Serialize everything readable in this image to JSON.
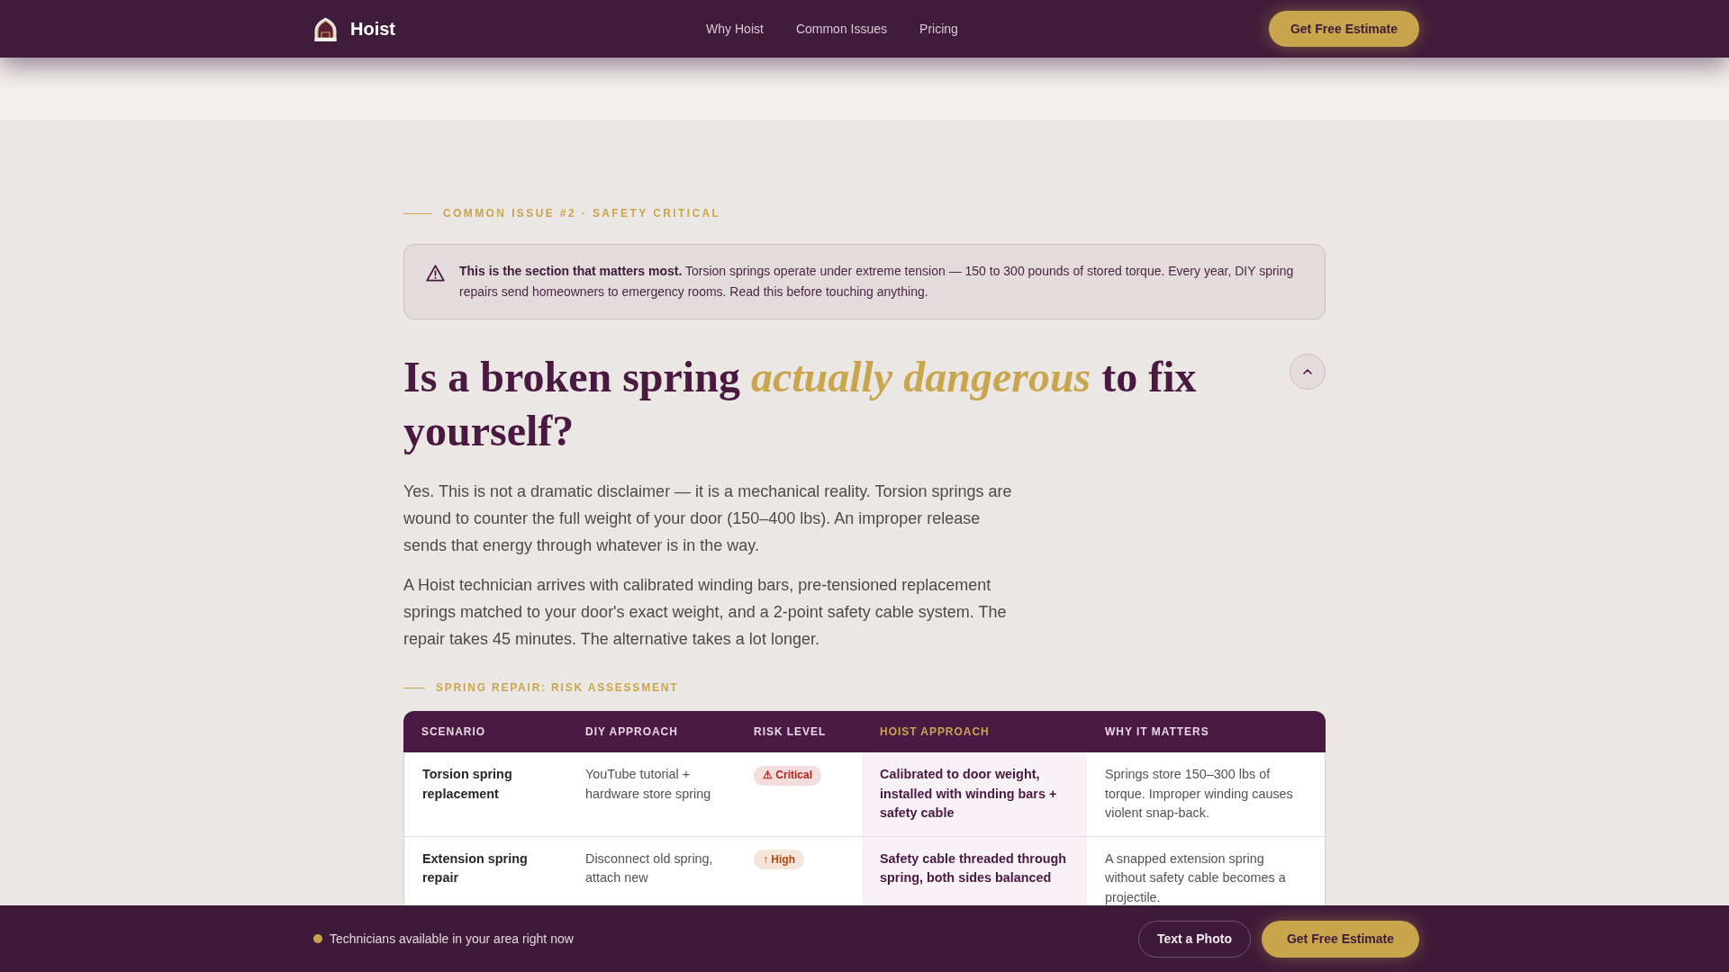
{
  "header": {
    "logo": "Hoist",
    "nav": [
      "Why Hoist",
      "Common Issues",
      "Pricing"
    ],
    "cta": "Get Free Estimate"
  },
  "issue": {
    "eyebrow": "COMMON ISSUE #2 · SAFETY CRITICAL",
    "alert": "**This is the section that matters most.** Torsion springs operate under extreme tension — 150 to 300 pounds of stored torque. Every year, DIY spring repairs send homeowners to emergency rooms. Read this before touching anything.",
    "heading": "Is a broken spring *actually dangerous* to fix yourself?",
    "paragraphs": [
      "Yes. This is not a dramatic disclaimer — it is a mechanical reality. Torsion springs are wound to counter the full weight of your door (150–400 lbs). An improper release sends that energy through whatever is in the way.",
      "A Hoist technician arrives with calibrated winding bars, pre-tensioned replacement springs matched to your door's exact weight, and a 2-point safety cable system. The repair takes 45 minutes. The alternative takes a lot longer."
    ]
  },
  "risk_table": {
    "label": "SPRING REPAIR: RISK ASSESSMENT",
    "columns": [
      {
        "label": "SCENARIO",
        "highlighted": false
      },
      {
        "label": "DIY APPROACH",
        "highlighted": false
      },
      {
        "label": "RISK LEVEL",
        "highlighted": false
      },
      {
        "label": "HOIST APPROACH",
        "highlighted": true
      },
      {
        "label": "WHY IT MATTERS",
        "highlighted": false
      }
    ],
    "rows": [
      {
        "scenario": "Torsion spring replacement",
        "diy": "YouTube tutorial + hardware store spring",
        "risk": {
          "text": "⚠ Critical",
          "color": "#b42318"
        },
        "hoist": "Calibrated to door weight, installed with winding bars + safety cable",
        "why": "Springs store 150–300 lbs of torque. Improper winding causes violent snap-back."
      },
      {
        "scenario": "Extension spring repair",
        "diy": "Disconnect old spring, attach new",
        "risk": {
          "text": "↑ High",
          "color": "#b54708"
        },
        "hoist": "Safety cable threaded through spring, both sides balanced",
        "why": "A snapped extension spring without safety cable becomes a projectile."
      }
    ]
  },
  "bottom_bar": {
    "status": "Technicians available in your area right now",
    "buttons": [
      {
        "label": "Text a Photo",
        "kind": "outline"
      },
      {
        "label": "Get Free Estimate",
        "kind": "primary"
      }
    ]
  }
}
